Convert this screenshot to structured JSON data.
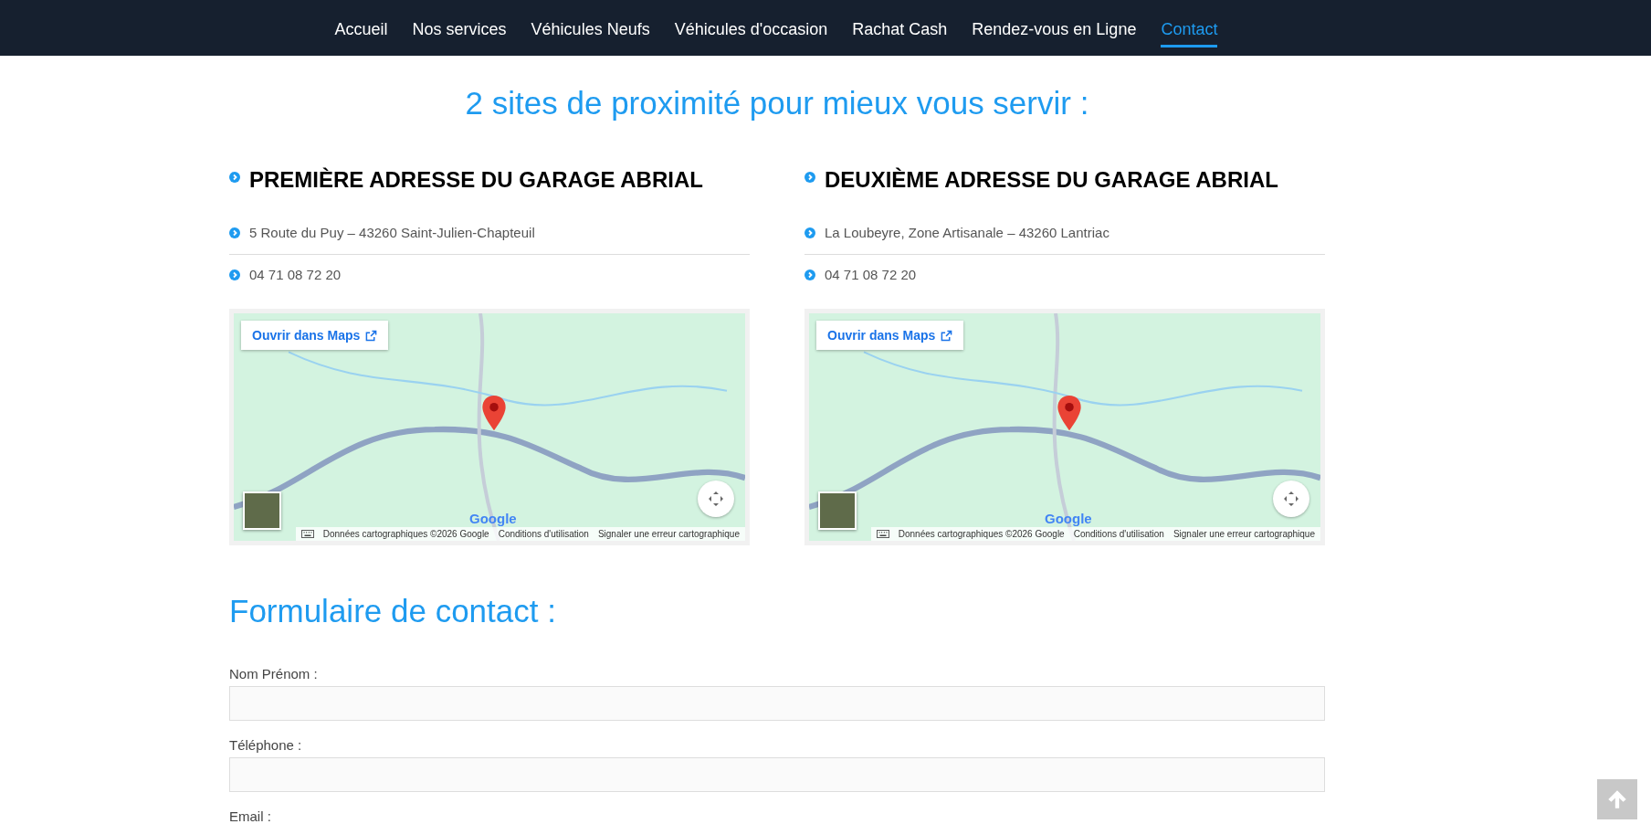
{
  "nav": {
    "items": [
      {
        "label": "Accueil",
        "selected": false
      },
      {
        "label": "Nos services",
        "selected": false
      },
      {
        "label": "Véhicules Neufs",
        "selected": false
      },
      {
        "label": "Véhicules d'occasion",
        "selected": false
      },
      {
        "label": "Rachat Cash",
        "selected": false
      },
      {
        "label": "Rendez-vous en Ligne",
        "selected": false
      },
      {
        "label": "Contact",
        "selected": true
      }
    ]
  },
  "title": "2 sites de proximité pour mieux vous servir :",
  "sites": [
    {
      "heading": "PREMIÈRE ADRESSE DU GARAGE ABRIAL",
      "address": "5 Route du Puy – 43260 Saint-Julien-Chapteuil",
      "phone": "04 71 08 72 20",
      "map": {
        "open_button": "Ouvrir dans Maps",
        "logo": "Google",
        "attribution": [
          "Données cartographiques ©2026 Google",
          "Conditions d'utilisation",
          "Signaler une erreur cartographique"
        ]
      }
    },
    {
      "heading": "DEUXIÈME ADRESSE DU GARAGE ABRIAL",
      "address": "La Loubeyre, Zone Artisanale – 43260 Lantriac",
      "phone": "04 71 08 72 20",
      "map": {
        "open_button": "Ouvrir dans Maps",
        "logo": "Google",
        "attribution": [
          "Données cartographiques ©2026 Google",
          "Conditions d'utilisation",
          "Signaler une erreur cartographique"
        ]
      }
    }
  ],
  "form": {
    "title": "Formulaire de contact :",
    "fields": [
      {
        "label": "Nom Prénom :"
      },
      {
        "label": "Téléphone :"
      },
      {
        "label": "Email :"
      }
    ]
  }
}
